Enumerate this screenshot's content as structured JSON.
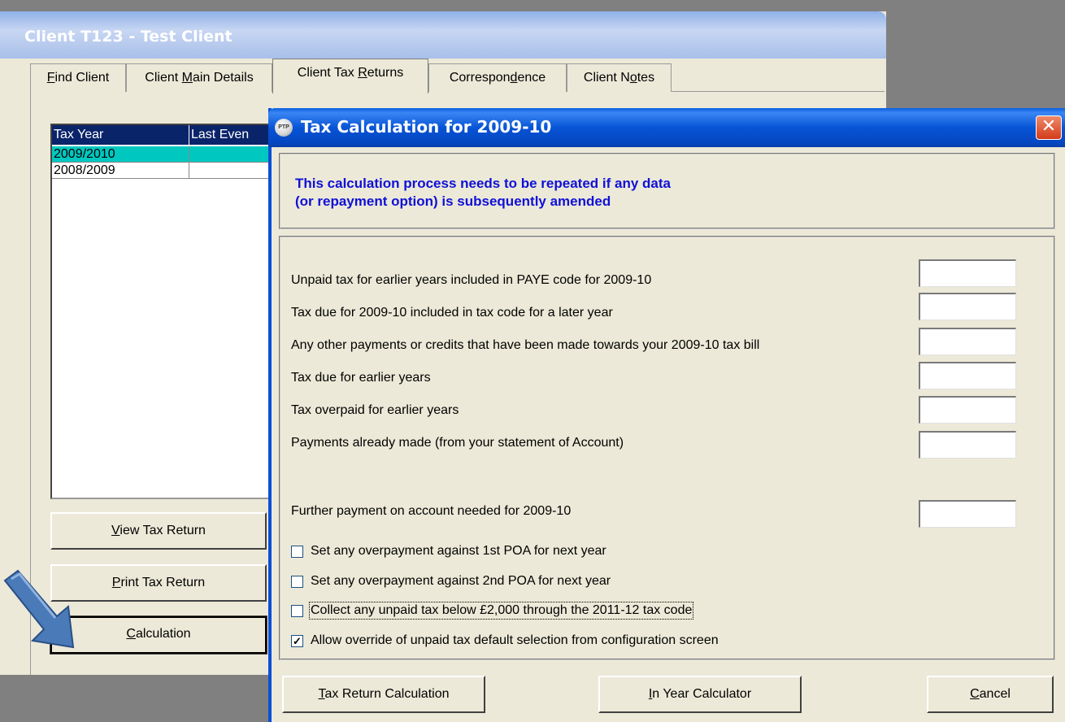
{
  "background_window": {
    "title": "Client T123 - Test Client",
    "tabs": [
      {
        "pre": "",
        "key": "F",
        "post": "ind Client"
      },
      {
        "pre": "Client ",
        "key": "M",
        "post": "ain Details"
      },
      {
        "pre": "Client Tax ",
        "key": "R",
        "post": "eturns"
      },
      {
        "pre": "Correspon",
        "key": "d",
        "post": "ence"
      },
      {
        "pre": "Client N",
        "key": "o",
        "post": "tes"
      }
    ],
    "grid": {
      "columns": [
        "Tax Year",
        "Last Even"
      ],
      "rows": [
        {
          "year": "2009/2010",
          "event": ""
        },
        {
          "year": "2008/2009",
          "event": ""
        }
      ]
    },
    "buttons": [
      {
        "pre": "",
        "key": "V",
        "post": "iew Tax Return"
      },
      {
        "pre": "",
        "key": "P",
        "post": "rint Tax Return"
      },
      {
        "pre": "",
        "key": "C",
        "post": "alculation"
      }
    ]
  },
  "dialog": {
    "title": "Tax Calculation for 2009-10",
    "icon_text": "PTP",
    "close_glyph": "✕",
    "header_line1": "This calculation process needs to be repeated if any data",
    "header_line2": "(or repayment option) is subsequently amended",
    "fields": [
      {
        "label": "Unpaid tax for earlier years included in PAYE code for 2009-10",
        "value": ""
      },
      {
        "label": "Tax due for 2009-10 included in tax code for a later year",
        "value": ""
      },
      {
        "label": "Any other payments or credits that have been made towards your 2009-10 tax bill",
        "value": ""
      },
      {
        "label": "Tax due for earlier years",
        "value": ""
      },
      {
        "label": "Tax overpaid for earlier years",
        "value": ""
      },
      {
        "label": "Payments already made (from your statement of Account)",
        "value": ""
      }
    ],
    "further_payment": {
      "label": "Further payment on account needed for 2009-10",
      "value": ""
    },
    "checkboxes": [
      {
        "label": "Set any overpayment against 1st POA for next year",
        "checked": false,
        "mark": ""
      },
      {
        "label": "Set any overpayment against 2nd POA for next year",
        "checked": false,
        "mark": ""
      },
      {
        "label": "Collect any unpaid tax below £2,000 through the 2011-12 tax code",
        "checked": false,
        "mark": ""
      },
      {
        "label": "Allow override of unpaid tax default selection from configuration screen",
        "checked": true,
        "mark": "✓"
      }
    ],
    "buttons": [
      {
        "pre": "",
        "key": "T",
        "post": "ax Return Calculation"
      },
      {
        "pre": "",
        "key": "I",
        "post": "n Year Calculator"
      },
      {
        "pre": "",
        "key": "C",
        "post": "ancel"
      }
    ]
  },
  "colors": {
    "dialog_title": "#0754d6",
    "header_text": "#1010d8",
    "grid_selected": "#00c8c0",
    "arrow": "#4a7ab8"
  }
}
